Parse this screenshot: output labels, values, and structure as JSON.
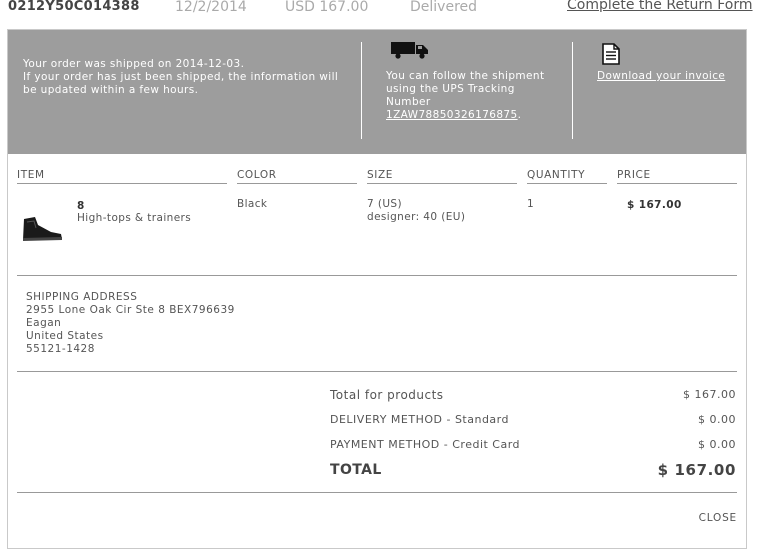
{
  "order": {
    "id": "0212Y50C014388",
    "date": "12/2/2014",
    "total": "USD 167.00",
    "status": "Delivered",
    "return_link": "Complete the Return Form"
  },
  "shipping_info": {
    "message_line1": "Your order was shipped on 2014-12-03.",
    "message_line2": "If your order has just been shipped, the information will",
    "message_line3": "be updated within a few hours.",
    "tracking_line1": "You can follow the shipment",
    "tracking_line2": "using the UPS Tracking",
    "tracking_line3": "Number",
    "tracking_number": "1ZAW78850326176875",
    "tracking_suffix": ".",
    "invoice_link": "Download your invoice"
  },
  "table": {
    "headers": {
      "item": "ITEM",
      "color": "COLOR",
      "size": "SIZE",
      "quantity": "QUANTITY",
      "price": "PRICE"
    },
    "rows": [
      {
        "item_code": "8",
        "item_name": "High-tops & trainers",
        "color": "Black",
        "size_us": "7 (US)",
        "size_designer": "designer: 40 (EU)",
        "quantity": "1",
        "price": "$ 167.00"
      }
    ]
  },
  "shipping_address": {
    "label": "SHIPPING ADDRESS",
    "line1": "2955 Lone Oak Cir Ste 8 BEX796639",
    "line2": "Eagan",
    "line3": "United States",
    "line4": "55121-1428"
  },
  "summary": {
    "products_label": "Total for products",
    "products_value": "$ 167.00",
    "delivery_label": "DELIVERY METHOD - Standard",
    "delivery_value": "$ 0.00",
    "payment_label": "PAYMENT METHOD - Credit Card",
    "payment_value": "$ 0.00",
    "total_label": "TOTAL",
    "total_value": "$ 167.00"
  },
  "close_label": "CLOSE",
  "icons": {
    "truck": "truck-icon",
    "document": "document-icon",
    "product": "sneaker-thumbnail"
  },
  "colors": {
    "banner_bg": "#9d9d9d",
    "text": "#555555"
  }
}
